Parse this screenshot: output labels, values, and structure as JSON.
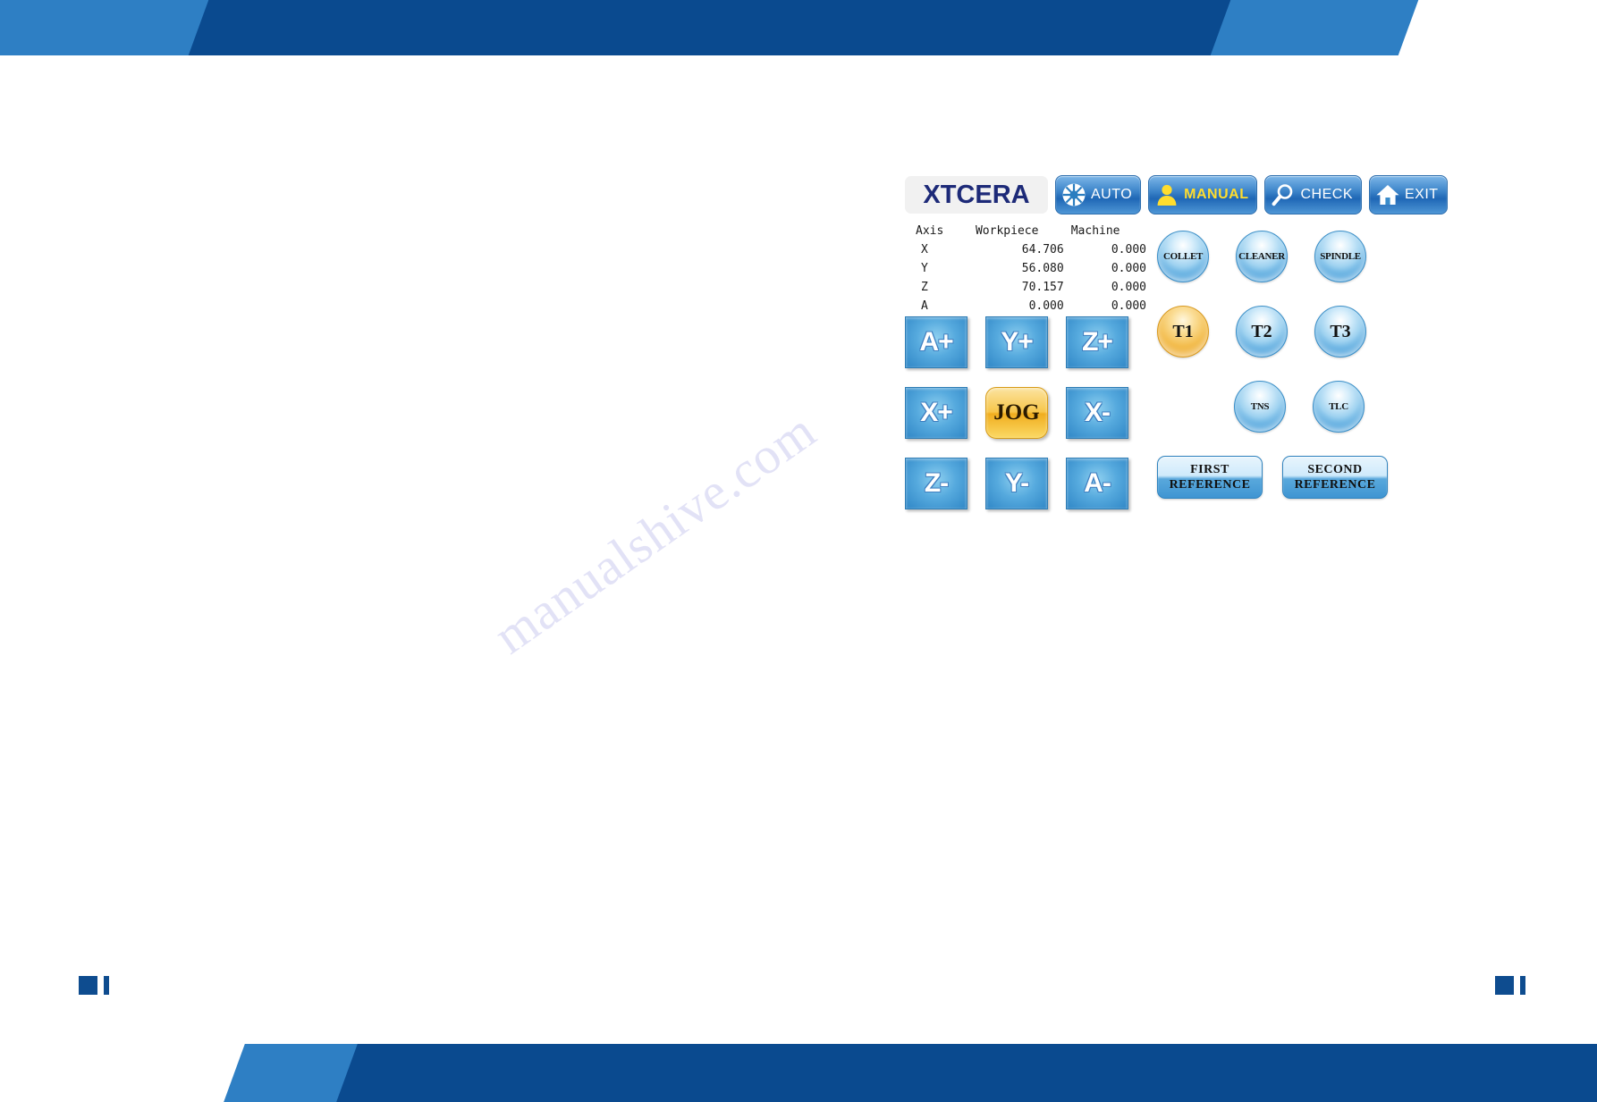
{
  "panel": {
    "brand": "XTCERA",
    "mode_tabs": [
      {
        "label": "AUTO",
        "icon": "gear-icon",
        "active": false
      },
      {
        "label": "MANUAL",
        "icon": "person-icon",
        "active": true
      },
      {
        "label": "CHECK",
        "icon": "magnifier-icon",
        "active": false
      },
      {
        "label": "EXIT",
        "icon": "home-icon",
        "active": false
      }
    ],
    "readout": {
      "headers": [
        "Axis",
        "Workpiece",
        "Machine"
      ],
      "rows": [
        {
          "axis": "X",
          "workpiece": "64.706",
          "machine": "0.000"
        },
        {
          "axis": "Y",
          "workpiece": "56.080",
          "machine": "0.000"
        },
        {
          "axis": "Z",
          "workpiece": "70.157",
          "machine": "0.000"
        },
        {
          "axis": "A",
          "workpiece": "0.000",
          "machine": "0.000"
        }
      ]
    },
    "jog_pad": [
      {
        "label": "A+",
        "center": false
      },
      {
        "label": "Y+",
        "center": false
      },
      {
        "label": "Z+",
        "center": false
      },
      {
        "label": "X+",
        "center": false
      },
      {
        "label": "JOG",
        "center": true
      },
      {
        "label": "X-",
        "center": false
      },
      {
        "label": "Z-",
        "center": false
      },
      {
        "label": "Y-",
        "center": false
      },
      {
        "label": "A-",
        "center": false
      }
    ],
    "device_buttons": [
      {
        "label": "COLLET",
        "active": false
      },
      {
        "label": "CLEANER",
        "active": false
      },
      {
        "label": "SPINDLE",
        "active": false
      }
    ],
    "tool_buttons": [
      {
        "label": "T1",
        "active": true
      },
      {
        "label": "T2",
        "active": false
      },
      {
        "label": "T3",
        "active": false
      }
    ],
    "sensor_buttons": [
      {
        "label": "TNS",
        "active": false
      },
      {
        "label": "TLC",
        "active": false
      }
    ],
    "reference_buttons": [
      {
        "line1": "FIRST",
        "line2": "REFERENCE"
      },
      {
        "line1": "SECOND",
        "line2": "REFERENCE"
      }
    ]
  },
  "page": {
    "watermark": "manualshive.com"
  },
  "colors": {
    "header_dark": "#0A4A8F",
    "header_light": "#2E7FC4",
    "brand_text": "#1d2a78",
    "active_tab_text": "#ffdd2e",
    "button_blue": "#2f86c6",
    "active_amber": "#f3bd4e"
  }
}
